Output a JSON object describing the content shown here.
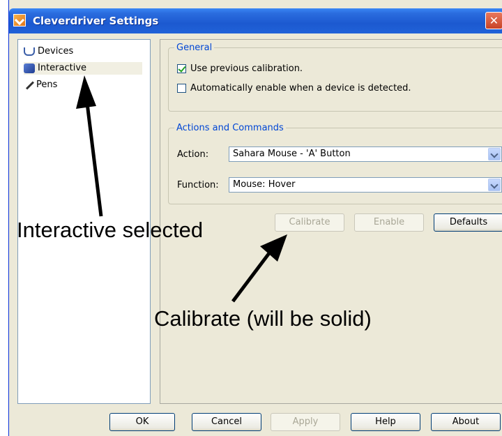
{
  "window": {
    "title": "Cleverdriver Settings",
    "close_glyph": "✕"
  },
  "sidebar": {
    "items": [
      {
        "label": "Devices",
        "icon": "devices-icon"
      },
      {
        "label": "Interactive",
        "icon": "interactive-icon",
        "selected": true
      },
      {
        "label": "Pens",
        "icon": "pen-icon"
      }
    ]
  },
  "general": {
    "legend": "General",
    "use_previous_calibration": {
      "label": "Use previous calibration.",
      "checked": true
    },
    "auto_enable": {
      "label": "Automatically enable when a device is detected.",
      "checked": false
    }
  },
  "actions": {
    "legend": "Actions and Commands",
    "action_label": "Action:",
    "action_value": "Sahara Mouse - 'A' Button",
    "function_label": "Function:",
    "function_value": "Mouse: Hover"
  },
  "panel_buttons": {
    "calibrate": "Calibrate",
    "enable": "Enable",
    "defaults": "Defaults"
  },
  "footer_buttons": {
    "ok": "OK",
    "cancel": "Cancel",
    "apply": "Apply",
    "help": "Help",
    "about": "About"
  },
  "annotations": {
    "interactive_note": "Interactive selected",
    "calibrate_note": "Calibrate (will be solid)"
  },
  "colors": {
    "title_bar": "#2a6cde",
    "legend": "#0046d5",
    "dialog_bg": "#ece9d8"
  }
}
